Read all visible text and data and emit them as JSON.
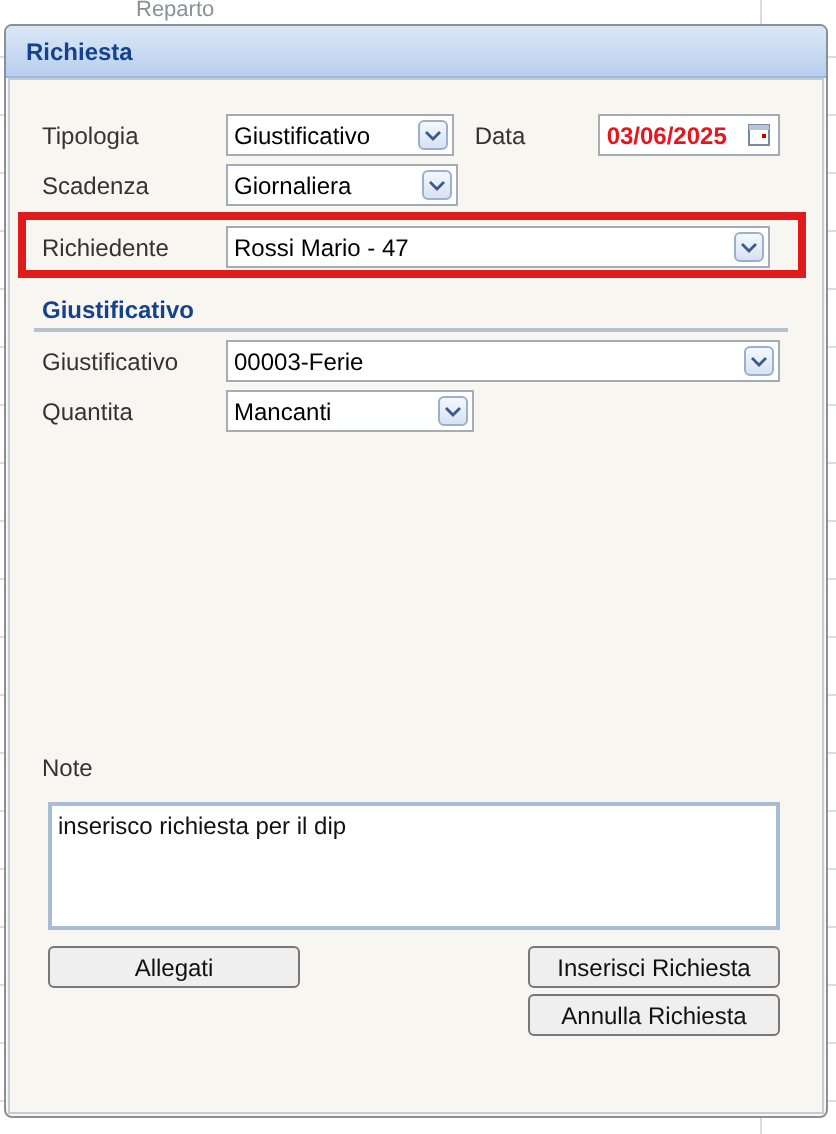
{
  "background": {
    "column_header": "Reparto"
  },
  "dialog": {
    "title": "Richiesta"
  },
  "fields": [
    {
      "label": "Tipologia",
      "kind": "select",
      "value": "Giustificativo",
      "highlighted": false,
      "side": {
        "label": "Data",
        "kind": "date",
        "value": "03/06/2025"
      }
    },
    {
      "label": "Scadenza",
      "kind": "select",
      "value": "Giornaliera",
      "highlighted": false
    },
    {
      "label": "Richiedente",
      "kind": "wide-select",
      "value": "Rossi Mario - 47",
      "highlighted": true
    }
  ],
  "section": {
    "title": "Giustificativo",
    "fields": [
      {
        "label": "Giustificativo",
        "kind": "wide-select",
        "value": "00003-Ferie",
        "highlighted": false
      },
      {
        "label": "Quantita",
        "kind": "select",
        "value": "Mancanti",
        "highlighted": false
      }
    ]
  },
  "note": {
    "label": "Note",
    "value": "inserisco richiesta per il dip"
  },
  "buttons": {
    "left": [
      "Allegati"
    ],
    "right": [
      "Inserisci Richiesta",
      "Annulla Richiesta"
    ]
  }
}
